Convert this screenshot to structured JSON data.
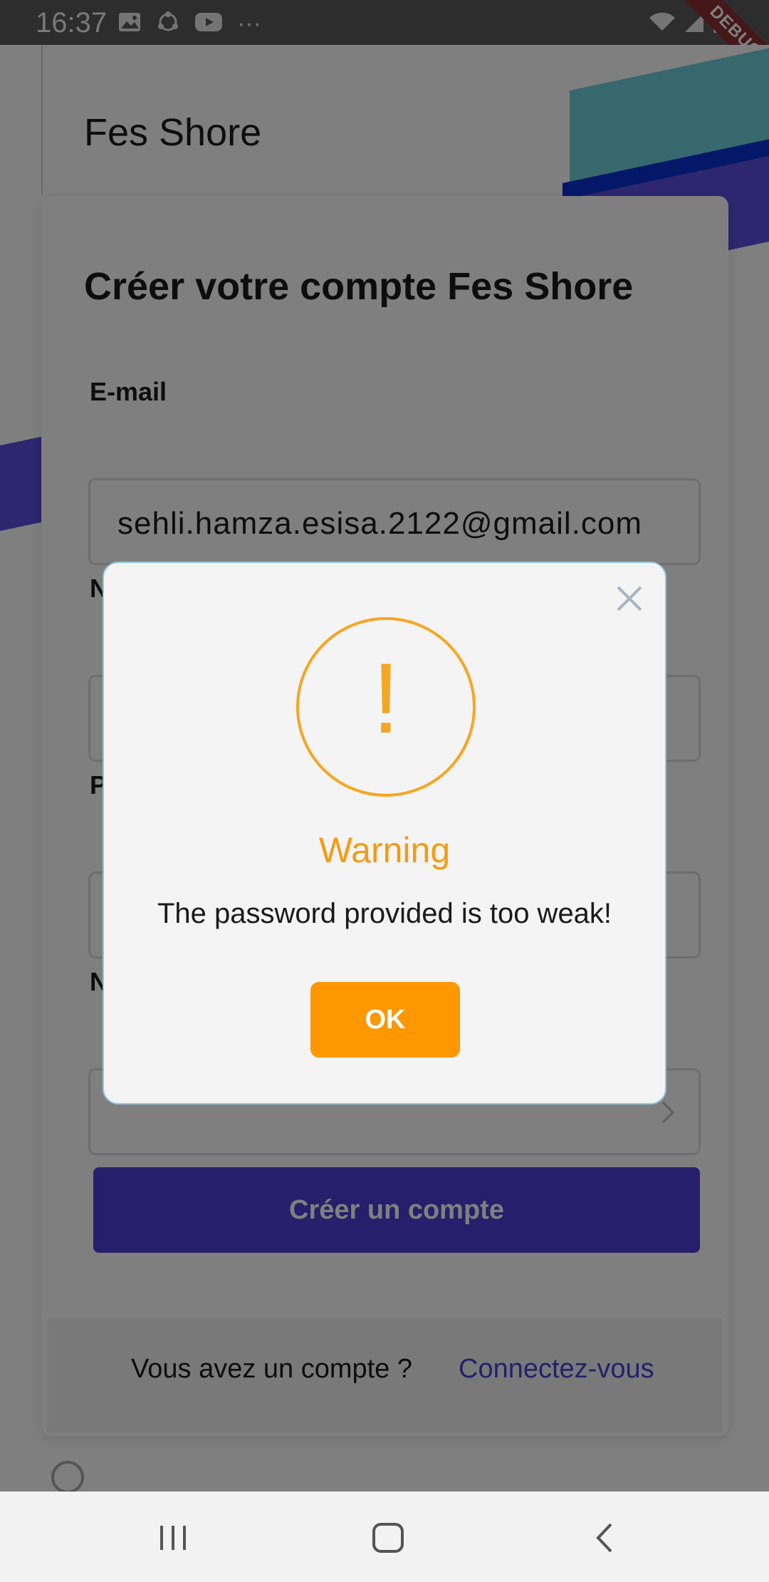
{
  "status": {
    "time": "16:37",
    "more": "···",
    "debug": "DEBUG"
  },
  "app": {
    "brand": "Fes Shore"
  },
  "form": {
    "title": "Créer votre compte Fes Shore",
    "email_label": "E-mail",
    "email_value": "sehli.hamza.esisa.2122@gmail.com",
    "label_2_partial": "N",
    "label_3_partial": "P",
    "label_4_partial": "N",
    "submit_label": "Créer un compte"
  },
  "footer": {
    "question": "Vous avez un compte ?",
    "link": "Connectez-vous"
  },
  "dialog": {
    "title": "Warning",
    "message": "The password provided is too weak!",
    "ok_label": "OK",
    "accent_color": "#F5A623"
  }
}
